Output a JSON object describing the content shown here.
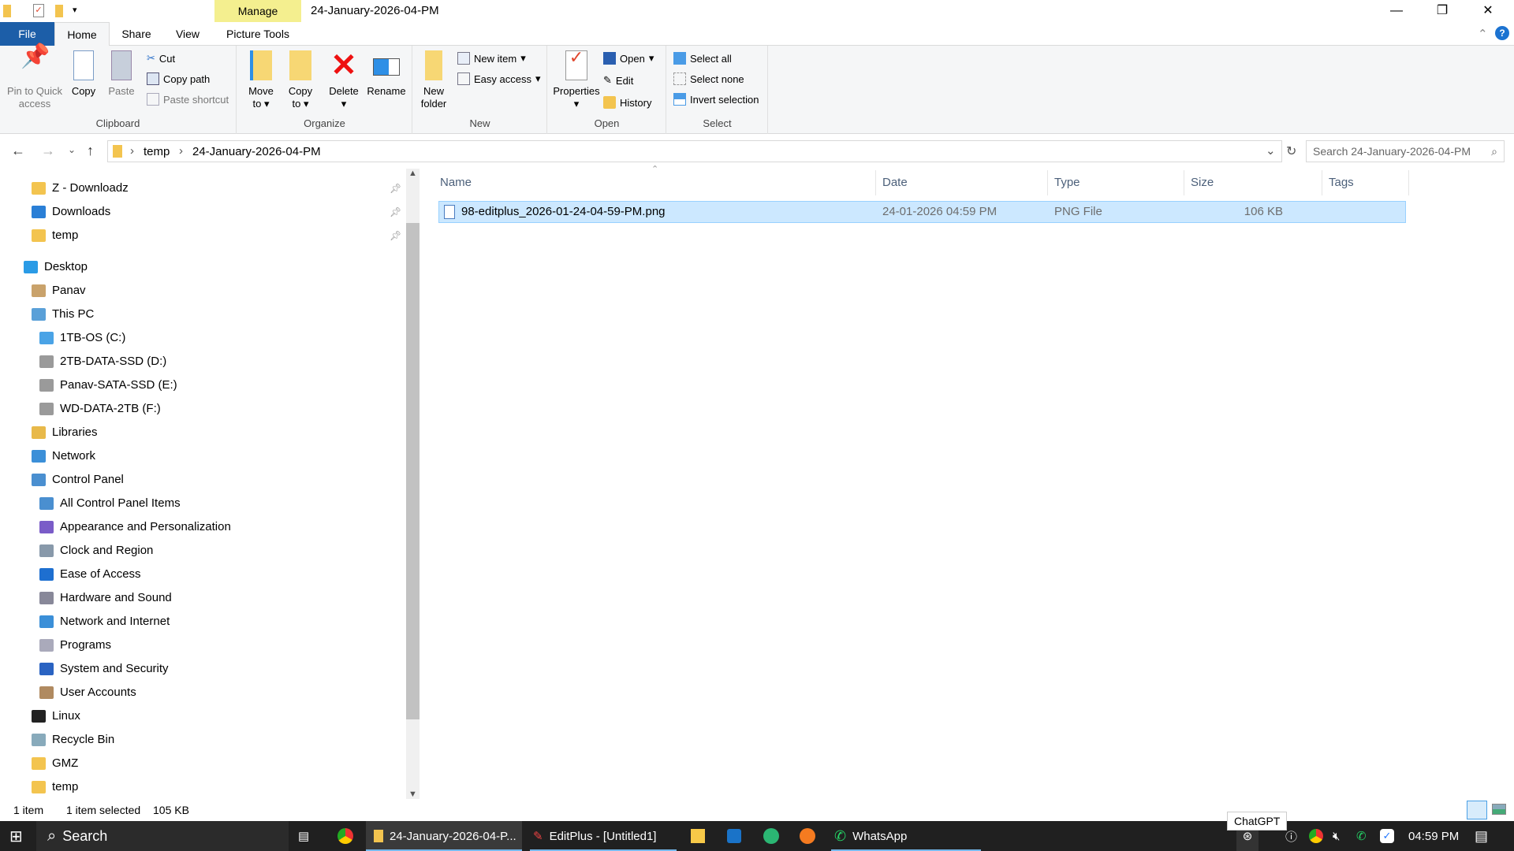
{
  "window": {
    "title": "24-January-2026-04-PM",
    "context_tab": "Manage",
    "context_group": "Picture Tools",
    "minimize": "—",
    "maximize": "❐",
    "close": "✕"
  },
  "tabs": [
    "File",
    "Home",
    "Share",
    "View",
    "Picture Tools"
  ],
  "ribbon": {
    "clipboard": {
      "label": "Clipboard",
      "pin": "Pin to Quick access",
      "copy": "Copy",
      "paste": "Paste",
      "cut": "Cut",
      "copy_path": "Copy path",
      "paste_shortcut": "Paste shortcut"
    },
    "organize": {
      "label": "Organize",
      "move_to": "Move to",
      "copy_to": "Copy to",
      "delete": "Delete",
      "rename": "Rename"
    },
    "new": {
      "label": "New",
      "new_folder": "New folder",
      "new_item": "New item",
      "easy_access": "Easy access"
    },
    "open": {
      "label": "Open",
      "properties": "Properties",
      "open": "Open",
      "edit": "Edit",
      "history": "History"
    },
    "select": {
      "label": "Select",
      "select_all": "Select all",
      "select_none": "Select none",
      "invert": "Invert selection"
    }
  },
  "address": {
    "crumbs": [
      "temp",
      "24-January-2026-04-PM"
    ],
    "search_placeholder": "Search 24-January-2026-04-PM"
  },
  "nav": [
    {
      "label": "Z - Downloadz",
      "indent": 1,
      "icon": "folder",
      "pin": true
    },
    {
      "label": "Downloads",
      "indent": 1,
      "icon": "download",
      "pin": true
    },
    {
      "label": "temp",
      "indent": 1,
      "icon": "folder",
      "pin": true
    },
    {
      "label": "Desktop",
      "indent": 0,
      "icon": "desktop",
      "gap": true
    },
    {
      "label": "Panav",
      "indent": 1,
      "icon": "user"
    },
    {
      "label": "This PC",
      "indent": 1,
      "icon": "pc"
    },
    {
      "label": "1TB-OS (C:)",
      "indent": 2,
      "icon": "drive-os"
    },
    {
      "label": "2TB-DATA-SSD (D:)",
      "indent": 2,
      "icon": "drive"
    },
    {
      "label": "Panav-SATA-SSD (E:)",
      "indent": 2,
      "icon": "drive"
    },
    {
      "label": "WD-DATA-2TB (F:)",
      "indent": 2,
      "icon": "drive"
    },
    {
      "label": "Libraries",
      "indent": 1,
      "icon": "library"
    },
    {
      "label": "Network",
      "indent": 1,
      "icon": "network"
    },
    {
      "label": "Control Panel",
      "indent": 1,
      "icon": "control"
    },
    {
      "label": "All Control Panel Items",
      "indent": 2,
      "icon": "control"
    },
    {
      "label": "Appearance and Personalization",
      "indent": 2,
      "icon": "appearance"
    },
    {
      "label": "Clock and Region",
      "indent": 2,
      "icon": "clock"
    },
    {
      "label": "Ease of Access",
      "indent": 2,
      "icon": "ease"
    },
    {
      "label": "Hardware and Sound",
      "indent": 2,
      "icon": "hardware"
    },
    {
      "label": "Network and Internet",
      "indent": 2,
      "icon": "network"
    },
    {
      "label": "Programs",
      "indent": 2,
      "icon": "programs"
    },
    {
      "label": "System and Security",
      "indent": 2,
      "icon": "shield"
    },
    {
      "label": "User Accounts",
      "indent": 2,
      "icon": "users"
    },
    {
      "label": "Linux",
      "indent": 1,
      "icon": "linux"
    },
    {
      "label": "Recycle Bin",
      "indent": 1,
      "icon": "recycle"
    },
    {
      "label": "GMZ",
      "indent": 1,
      "icon": "folder"
    },
    {
      "label": "temp",
      "indent": 1,
      "icon": "folder"
    }
  ],
  "columns": [
    "Name",
    "Date",
    "Type",
    "Size",
    "Tags"
  ],
  "files": [
    {
      "name": "98-editplus_2026-01-24-04-59-PM.png",
      "date": "24-01-2026 04:59 PM",
      "type": "PNG File",
      "size": "106 KB",
      "tags": ""
    }
  ],
  "status": {
    "count": "1 item",
    "selected": "1 item selected",
    "size": "105 KB"
  },
  "taskbar": {
    "search": "Search",
    "explorer": "24-January-2026-04-P...",
    "editplus": "EditPlus - [Untitled1]",
    "whatsapp": "WhatsApp",
    "tooltip": "ChatGPT",
    "time": "04:59 PM"
  },
  "colors": {
    "accent": "#1c5ea8",
    "selection": "#cce8ff",
    "manage": "#f4ef8f",
    "taskbar": "#202020"
  }
}
